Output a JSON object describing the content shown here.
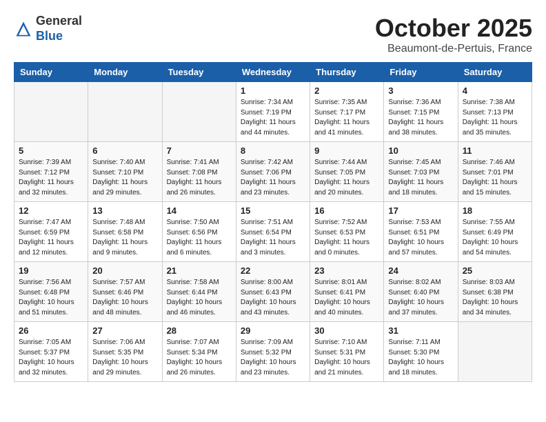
{
  "header": {
    "logo_general": "General",
    "logo_blue": "Blue",
    "month_title": "October 2025",
    "location": "Beaumont-de-Pertuis, France"
  },
  "weekdays": [
    "Sunday",
    "Monday",
    "Tuesday",
    "Wednesday",
    "Thursday",
    "Friday",
    "Saturday"
  ],
  "weeks": [
    [
      {
        "day": "",
        "info": ""
      },
      {
        "day": "",
        "info": ""
      },
      {
        "day": "",
        "info": ""
      },
      {
        "day": "1",
        "info": "Sunrise: 7:34 AM\nSunset: 7:19 PM\nDaylight: 11 hours\nand 44 minutes."
      },
      {
        "day": "2",
        "info": "Sunrise: 7:35 AM\nSunset: 7:17 PM\nDaylight: 11 hours\nand 41 minutes."
      },
      {
        "day": "3",
        "info": "Sunrise: 7:36 AM\nSunset: 7:15 PM\nDaylight: 11 hours\nand 38 minutes."
      },
      {
        "day": "4",
        "info": "Sunrise: 7:38 AM\nSunset: 7:13 PM\nDaylight: 11 hours\nand 35 minutes."
      }
    ],
    [
      {
        "day": "5",
        "info": "Sunrise: 7:39 AM\nSunset: 7:12 PM\nDaylight: 11 hours\nand 32 minutes."
      },
      {
        "day": "6",
        "info": "Sunrise: 7:40 AM\nSunset: 7:10 PM\nDaylight: 11 hours\nand 29 minutes."
      },
      {
        "day": "7",
        "info": "Sunrise: 7:41 AM\nSunset: 7:08 PM\nDaylight: 11 hours\nand 26 minutes."
      },
      {
        "day": "8",
        "info": "Sunrise: 7:42 AM\nSunset: 7:06 PM\nDaylight: 11 hours\nand 23 minutes."
      },
      {
        "day": "9",
        "info": "Sunrise: 7:44 AM\nSunset: 7:05 PM\nDaylight: 11 hours\nand 20 minutes."
      },
      {
        "day": "10",
        "info": "Sunrise: 7:45 AM\nSunset: 7:03 PM\nDaylight: 11 hours\nand 18 minutes."
      },
      {
        "day": "11",
        "info": "Sunrise: 7:46 AM\nSunset: 7:01 PM\nDaylight: 11 hours\nand 15 minutes."
      }
    ],
    [
      {
        "day": "12",
        "info": "Sunrise: 7:47 AM\nSunset: 6:59 PM\nDaylight: 11 hours\nand 12 minutes."
      },
      {
        "day": "13",
        "info": "Sunrise: 7:48 AM\nSunset: 6:58 PM\nDaylight: 11 hours\nand 9 minutes."
      },
      {
        "day": "14",
        "info": "Sunrise: 7:50 AM\nSunset: 6:56 PM\nDaylight: 11 hours\nand 6 minutes."
      },
      {
        "day": "15",
        "info": "Sunrise: 7:51 AM\nSunset: 6:54 PM\nDaylight: 11 hours\nand 3 minutes."
      },
      {
        "day": "16",
        "info": "Sunrise: 7:52 AM\nSunset: 6:53 PM\nDaylight: 11 hours\nand 0 minutes."
      },
      {
        "day": "17",
        "info": "Sunrise: 7:53 AM\nSunset: 6:51 PM\nDaylight: 10 hours\nand 57 minutes."
      },
      {
        "day": "18",
        "info": "Sunrise: 7:55 AM\nSunset: 6:49 PM\nDaylight: 10 hours\nand 54 minutes."
      }
    ],
    [
      {
        "day": "19",
        "info": "Sunrise: 7:56 AM\nSunset: 6:48 PM\nDaylight: 10 hours\nand 51 minutes."
      },
      {
        "day": "20",
        "info": "Sunrise: 7:57 AM\nSunset: 6:46 PM\nDaylight: 10 hours\nand 48 minutes."
      },
      {
        "day": "21",
        "info": "Sunrise: 7:58 AM\nSunset: 6:44 PM\nDaylight: 10 hours\nand 46 minutes."
      },
      {
        "day": "22",
        "info": "Sunrise: 8:00 AM\nSunset: 6:43 PM\nDaylight: 10 hours\nand 43 minutes."
      },
      {
        "day": "23",
        "info": "Sunrise: 8:01 AM\nSunset: 6:41 PM\nDaylight: 10 hours\nand 40 minutes."
      },
      {
        "day": "24",
        "info": "Sunrise: 8:02 AM\nSunset: 6:40 PM\nDaylight: 10 hours\nand 37 minutes."
      },
      {
        "day": "25",
        "info": "Sunrise: 8:03 AM\nSunset: 6:38 PM\nDaylight: 10 hours\nand 34 minutes."
      }
    ],
    [
      {
        "day": "26",
        "info": "Sunrise: 7:05 AM\nSunset: 5:37 PM\nDaylight: 10 hours\nand 32 minutes."
      },
      {
        "day": "27",
        "info": "Sunrise: 7:06 AM\nSunset: 5:35 PM\nDaylight: 10 hours\nand 29 minutes."
      },
      {
        "day": "28",
        "info": "Sunrise: 7:07 AM\nSunset: 5:34 PM\nDaylight: 10 hours\nand 26 minutes."
      },
      {
        "day": "29",
        "info": "Sunrise: 7:09 AM\nSunset: 5:32 PM\nDaylight: 10 hours\nand 23 minutes."
      },
      {
        "day": "30",
        "info": "Sunrise: 7:10 AM\nSunset: 5:31 PM\nDaylight: 10 hours\nand 21 minutes."
      },
      {
        "day": "31",
        "info": "Sunrise: 7:11 AM\nSunset: 5:30 PM\nDaylight: 10 hours\nand 18 minutes."
      },
      {
        "day": "",
        "info": ""
      }
    ]
  ]
}
